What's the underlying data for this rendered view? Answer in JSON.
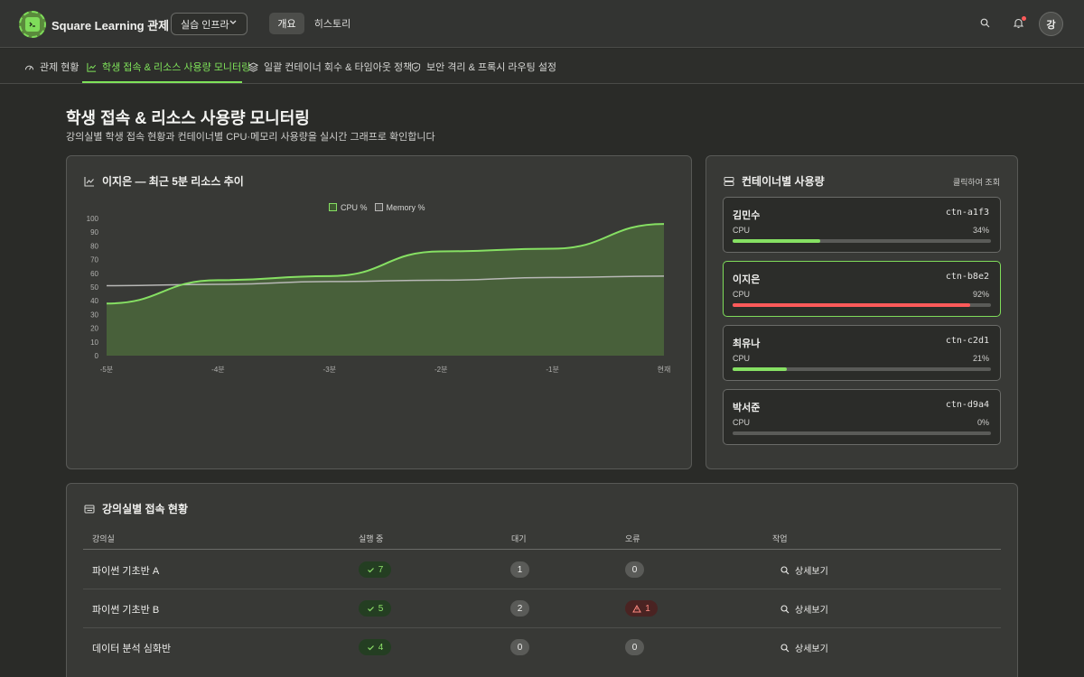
{
  "app": {
    "title": "Square Learning 관제",
    "env_select": "실습 인프라",
    "nav": [
      "개요",
      "히스토리"
    ],
    "avatar_initial": "강"
  },
  "tabs": [
    {
      "label": "관제 현황",
      "icon": "gauge-icon"
    },
    {
      "label": "학생 접속 & 리소스 사용량 모니터링",
      "icon": "line-chart-icon"
    },
    {
      "label": "일괄 컨테이너 회수 & 타임아웃 정책",
      "icon": "layers-icon"
    },
    {
      "label": "보안 격리 & 프록시 라우팅 설정",
      "icon": "shield-icon"
    }
  ],
  "page": {
    "title": "학생 접속 & 리소스 사용량 모니터링",
    "subtitle": "강의실별 학생 접속 현황과 컨테이너별 CPU·메모리 사용량을 실시간 그래프로 확인합니다"
  },
  "chart_panel": {
    "title": "이지은 — 최근 5분 리소스 추이"
  },
  "chart_data": {
    "type": "area",
    "x": [
      "-5분",
      "-4분",
      "-3분",
      "-2분",
      "-1분",
      "현재"
    ],
    "series": [
      {
        "name": "CPU %",
        "values": [
          38,
          55,
          58,
          76,
          78,
          96
        ],
        "color": "#86e063"
      },
      {
        "name": "Memory %",
        "values": [
          51,
          52,
          54,
          55,
          57,
          58
        ],
        "color": "#b8b8b6"
      }
    ],
    "ylim": [
      0,
      100
    ],
    "yticks": [
      "0",
      "10",
      "20",
      "30",
      "40",
      "50",
      "60",
      "70",
      "80",
      "90",
      "100"
    ],
    "legend": "top-center"
  },
  "containers_panel": {
    "title": "컨테이너별 사용량",
    "hint": "클릭하여 조회",
    "items": [
      {
        "name": "김민수",
        "id": "ctn-a1f3",
        "label": "CPU",
        "cpu_text": "34%",
        "cpu": 34,
        "color": "#86e063"
      },
      {
        "name": "이지은",
        "id": "ctn-b8e2",
        "label": "CPU",
        "cpu_text": "92%",
        "cpu": 92,
        "color": "#ff5a5a"
      },
      {
        "name": "최유나",
        "id": "ctn-c2d1",
        "label": "CPU",
        "cpu_text": "21%",
        "cpu": 21,
        "color": "#86e063"
      },
      {
        "name": "박서준",
        "id": "ctn-d9a4",
        "label": "CPU",
        "cpu_text": "0%",
        "cpu": 0,
        "color": "#86e063"
      }
    ]
  },
  "table_panel": {
    "title": "강의실별 접속 현황",
    "headers": [
      "강의실",
      "실행 중",
      "대기",
      "오류",
      "작업"
    ],
    "rows": [
      {
        "room": "파이썬 기초반 A",
        "running": "7",
        "waiting": "1",
        "error": "0",
        "error_flag": false,
        "action": "상세보기"
      },
      {
        "room": "파이썬 기초반 B",
        "running": "5",
        "waiting": "2",
        "error": "1",
        "error_flag": true,
        "action": "상세보기"
      },
      {
        "room": "데이터 분석 심화반",
        "running": "4",
        "waiting": "0",
        "error": "0",
        "error_flag": false,
        "action": "상세보기"
      }
    ]
  }
}
